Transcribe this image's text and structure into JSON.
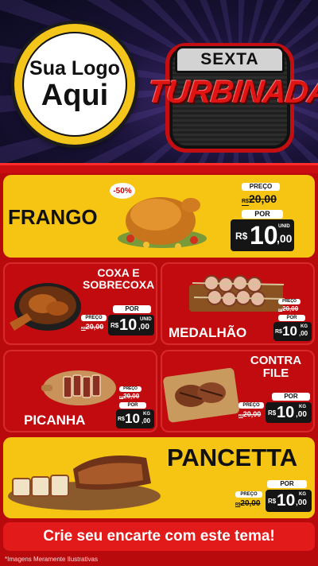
{
  "header": {
    "logo_line1": "Sua Logo",
    "logo_line2": "Aqui",
    "badge_top": "SEXTA",
    "badge_main": "TURBINADA"
  },
  "labels": {
    "preco": "PREÇO",
    "por": "POR",
    "currency": "R$"
  },
  "products": {
    "frango": {
      "name": "FRANGO",
      "discount": "-50%",
      "old_price": "20,00",
      "price_int": "10",
      "price_cents": ",00",
      "unit": "UNID"
    },
    "coxa": {
      "name_l1": "COXA E",
      "name_l2": "SOBRECOXA",
      "old_price": "20,00",
      "price_int": "10",
      "price_cents": ",00",
      "unit": "UNID"
    },
    "medalhao": {
      "name": "MEDALHÃO",
      "old_price": "20,00",
      "price_int": "10",
      "price_cents": ",00",
      "unit": "KG"
    },
    "picanha": {
      "name": "PICANHA",
      "old_price": "20,00",
      "price_int": "10",
      "price_cents": ",00",
      "unit": "KG"
    },
    "contrafile": {
      "name_l1": "CONTRA",
      "name_l2": "FILE",
      "old_price": "20,00",
      "price_int": "10",
      "price_cents": ",00",
      "unit": "KG"
    },
    "pancetta": {
      "name": "PANCETTA",
      "old_price": "20,00",
      "price_int": "10",
      "price_cents": ",00",
      "unit": "KG"
    }
  },
  "cta": "Crie seu encarte com este tema!",
  "footnote": "*Imagens Meramente Ilustrativas",
  "colors": {
    "red": "#c10b0e",
    "yellow": "#f6c413",
    "dark": "#151515",
    "cta": "#e21a1a"
  }
}
